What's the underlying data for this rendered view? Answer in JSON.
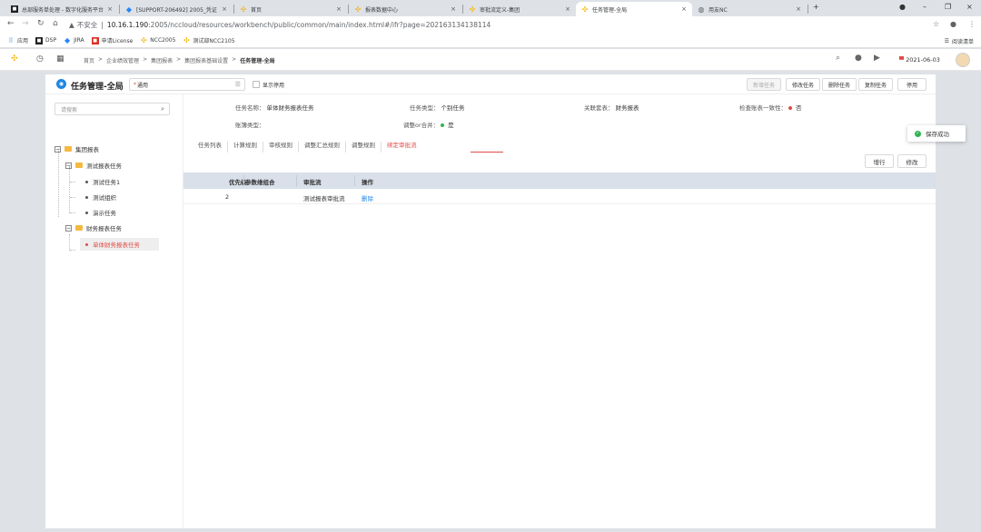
{
  "browser": {
    "tabs": [
      {
        "label": "总部服务单处理 - 数字化服务平台",
        "icon": "app-icon"
      },
      {
        "label": "[SUPPORT-206492] 2005_凭证",
        "icon": "jira-icon"
      },
      {
        "label": "首页",
        "icon": "nc-icon"
      },
      {
        "label": "报表数据中心",
        "icon": "nc-icon"
      },
      {
        "label": "审批流定义-集团",
        "icon": "nc-icon"
      },
      {
        "label": "任务管理-全局",
        "icon": "nc-icon"
      },
      {
        "label": "用友NC",
        "icon": "globe-icon"
      }
    ],
    "active_tab": 5,
    "new_tab_label": "+",
    "address": {
      "security": "不安全",
      "separator": "|",
      "host": "10.16.1.190",
      "path": ":2005/nccloud/resources/workbench/public/common/main/index.html#/ifr?page=202163134138114"
    },
    "bookmarks": [
      {
        "label": "应用"
      },
      {
        "label": "DSP"
      },
      {
        "label": "JIRA"
      },
      {
        "label": "申请License"
      },
      {
        "label": "NCC2005"
      },
      {
        "label": "测试部NCC2105"
      }
    ],
    "reading_mode": "阅读清单"
  },
  "header": {
    "breadcrumb": [
      "首页",
      ">",
      "企业绩效管理",
      ">",
      "集团报表",
      ">",
      "集团报表基础设置",
      ">"
    ],
    "breadcrumb_current": "任务管理-全局",
    "date": "2021-06-03"
  },
  "page": {
    "title": "任务管理-全局",
    "org_required_mark": "*",
    "org_value": "通用",
    "show_disabled_label": "显示停用",
    "buttons": {
      "new_task": "新增任务",
      "edit_task": "修改任务",
      "delete_task": "删除任务",
      "copy_task": "复制任务",
      "disable": "停用"
    }
  },
  "tree": {
    "search_placeholder": "请搜索",
    "nodes": {
      "root": "集团报表",
      "test_task_group": "测试报表任务",
      "test_task_1": "测试任务1",
      "test_org": "测试组织",
      "demo_task": "演示任务",
      "fin_task_group": "财务报表任务",
      "single_fin_task": "单体财务报表任务"
    }
  },
  "detail": {
    "task_name_label": "任务名称：",
    "task_name": "单体财务报表任务",
    "task_type_label": "任务类型：",
    "task_type": "个别任务",
    "linked_set_label": "关联套表：",
    "linked_set": "财务报表",
    "check_consistency_label": "检查账表一致性：",
    "check_consistency": "否",
    "ledger_type_label": "账簿类型：",
    "ledger_type": "",
    "adjust_merge_label": "调整or合并：",
    "adjust_merge": "是"
  },
  "tabs": [
    "任务列表",
    "计算规则",
    "审核规则",
    "调整汇总规则",
    "调整规则",
    "绑定审批流"
  ],
  "active_tab": 5,
  "table": {
    "add_row": "增行",
    "edit": "修改",
    "columns": [
      "优先级",
      "参数维组合",
      "审批流",
      "操作"
    ],
    "rows": [
      {
        "priority": "2",
        "params": "",
        "flow": "测试报表审批流",
        "action": "删除"
      }
    ]
  },
  "toast": {
    "message": "保存成功"
  },
  "colors": {
    "accent": "#e14c46",
    "primary": "#1e88e5",
    "success": "#2db44f",
    "table_header": "#d9e0ea"
  }
}
